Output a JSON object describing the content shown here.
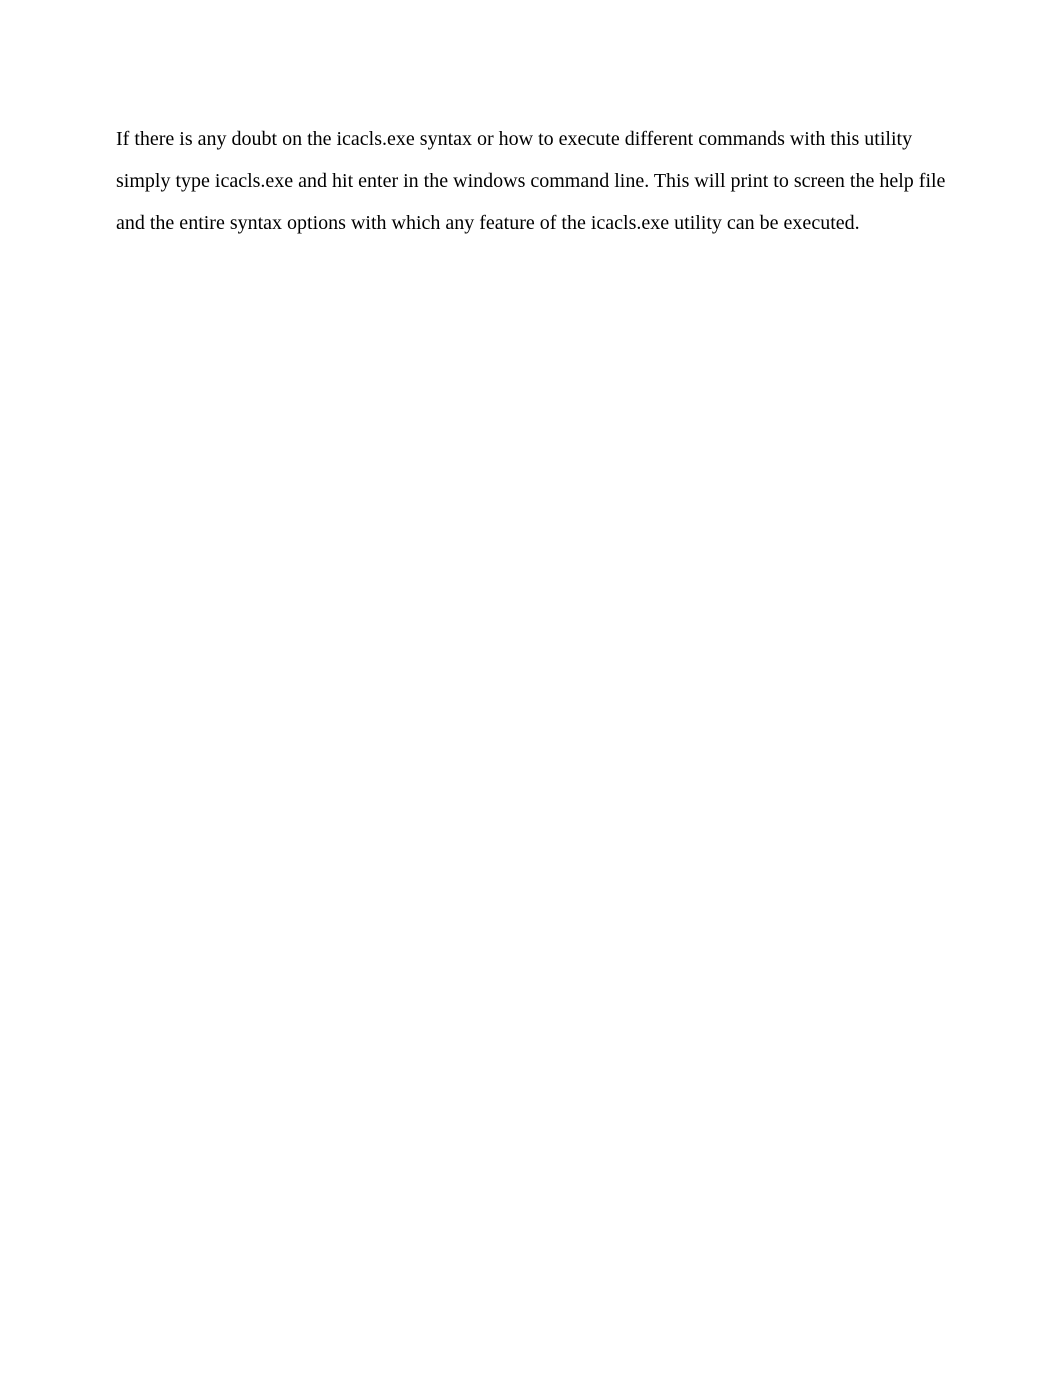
{
  "document": {
    "paragraph": "If there is any doubt on the icacls.exe syntax or how to execute different commands with this utility simply type icacls.exe and hit enter in the windows command line. This will print to screen the help file and the entire syntax options with which any feature of the icacls.exe utility can be executed."
  }
}
